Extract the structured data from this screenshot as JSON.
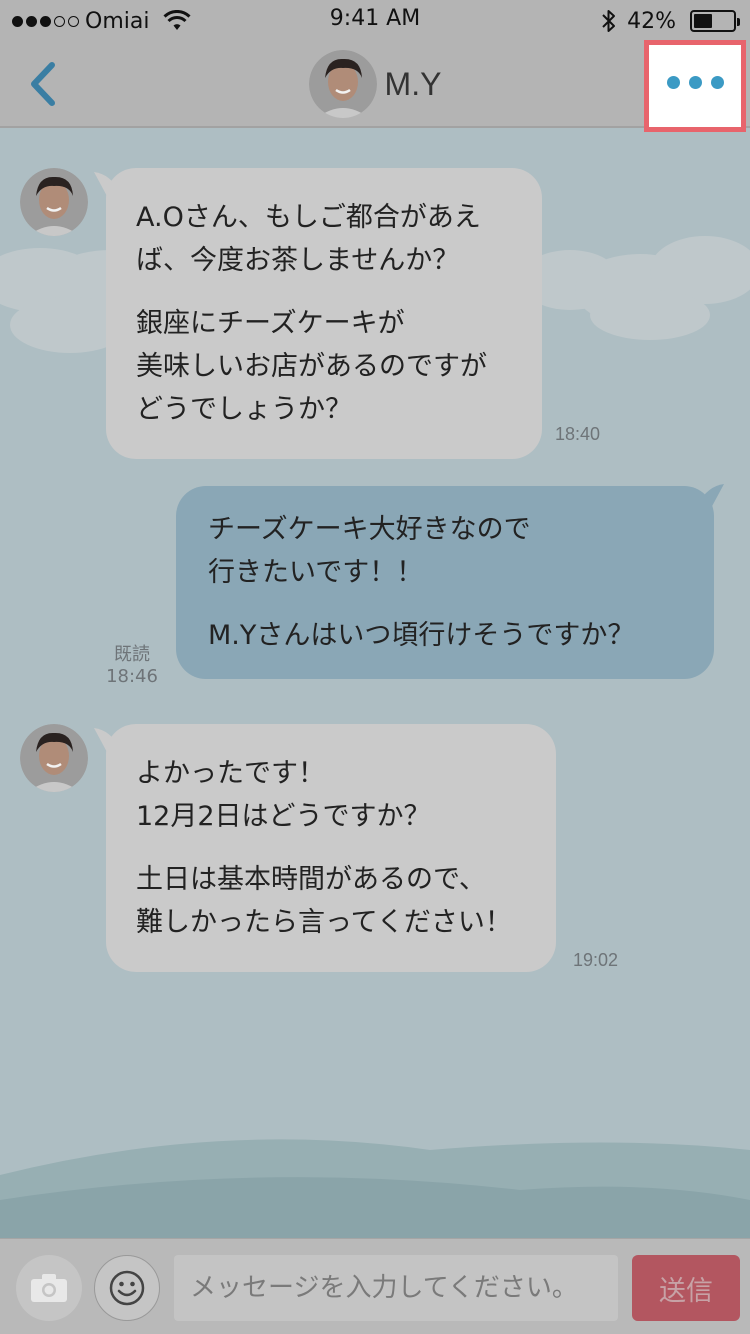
{
  "status_bar": {
    "carrier": "Omiai",
    "time": "9:41 AM",
    "battery_percent": "42%",
    "battery_level": 0.42,
    "signal_bars_filled": 3,
    "signal_bars_total": 5
  },
  "header": {
    "back_icon": "chevron-left-icon",
    "title": "M.Y",
    "more_icon": "ellipsis-icon",
    "accent_color": "#3b9ac4",
    "highlight_color": "#e8646c"
  },
  "messages": [
    {
      "direction": "incoming",
      "paragraphs": [
        "A.Oさん、もしご都合があえ\nば、今度お茶しませんか？",
        "銀座にチーズケーキが\n美味しいお店があるのですが\nどうでしょうか？"
      ],
      "time": "18:40"
    },
    {
      "direction": "outgoing",
      "paragraphs": [
        "チーズケーキ大好きなので\n行きたいです！！",
        "M.Yさんはいつ頃行けそうですか？"
      ],
      "read_label": "既読",
      "time": "18:46"
    },
    {
      "direction": "incoming",
      "paragraphs": [
        "よかったです！\n12月2日はどうですか？",
        "土日は基本時間があるので、\n難しかったら言ってください！"
      ],
      "time": "19:02"
    }
  ],
  "input_bar": {
    "camera_icon": "camera-icon",
    "emoji_icon": "smiley-icon",
    "placeholder": "メッセージを入力してください。",
    "send_label": "送信",
    "send_color": "#b35660"
  }
}
